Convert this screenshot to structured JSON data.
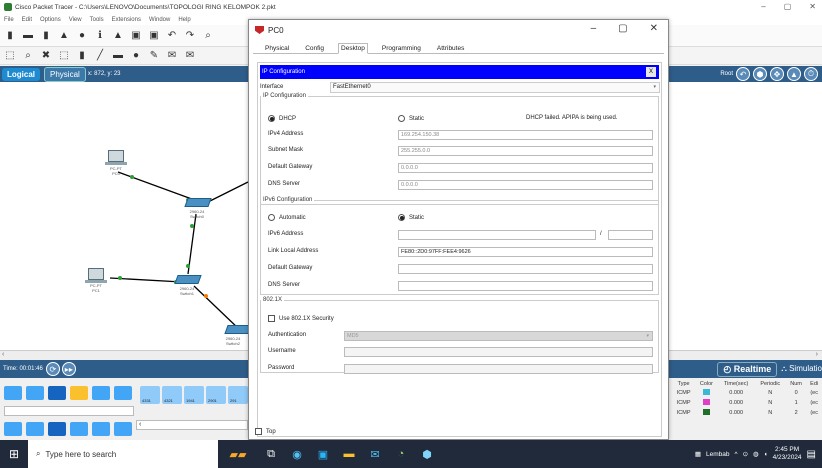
{
  "app": {
    "title": "Cisco Packet Tracer - C:\\Users\\LENOVO\\Documents\\TOPOLOGI RING KELOMPOK 2.pkt",
    "menu": [
      "File",
      "Edit",
      "Options",
      "View",
      "Tools",
      "Extensions",
      "Window",
      "Help"
    ],
    "logical_label": "Logical",
    "physical_label": "Physical",
    "coords": "x: 872, y: 23",
    "root_label": "Root",
    "time_label": "Time: 00:01:46",
    "realtime_label": "Realtime",
    "simulation_label": "Simulatio"
  },
  "devices": [
    {
      "label": "PC-PT\nPC0"
    },
    {
      "label": "2960-24\nSwitch0"
    },
    {
      "label": "PC-PT\nPC1"
    },
    {
      "label": "2960-24\nSwitch1"
    },
    {
      "label": "2960-24\nSwitch2"
    }
  ],
  "device_panel": {
    "model_labels": [
      "4331",
      "4321",
      "1941",
      "2901",
      "291"
    ]
  },
  "event_list": {
    "headers": [
      "Type",
      "Color",
      "Time(sec)",
      "Periodic",
      "Num",
      "Edi"
    ],
    "rows": [
      {
        "type": "ICMP",
        "color": "#3bb8d6",
        "time": "0.000",
        "periodic": "N",
        "num": "0",
        "edit": "(ec"
      },
      {
        "type": "ICMP",
        "color": "#e040c8",
        "time": "0.000",
        "periodic": "N",
        "num": "1",
        "edit": "(ec"
      },
      {
        "type": "ICMP",
        "color": "#1f6e2a",
        "time": "0.000",
        "periodic": "N",
        "num": "2",
        "edit": "(ec"
      }
    ]
  },
  "dialog": {
    "title": "PC0",
    "tabs": [
      "Physical",
      "Config",
      "Desktop",
      "Programming",
      "Attributes"
    ],
    "active_tab": "Desktop",
    "header": "IP Configuration",
    "close_x": "X",
    "interface_label": "Interface",
    "interface_value": "FastEthernet0",
    "ip_config": {
      "legend": "IP Configuration",
      "dhcp_label": "DHCP",
      "static_label": "Static",
      "status": "DHCP failed. APIPA is being used.",
      "ipv4_label": "IPv4 Address",
      "ipv4_value": "169.254.150.38",
      "mask_label": "Subnet Mask",
      "mask_value": "255.255.0.0",
      "gateway_label": "Default Gateway",
      "gateway_value": "0.0.0.0",
      "dns_label": "DNS Server",
      "dns_value": "0.0.0.0"
    },
    "ipv6_config": {
      "legend": "IPv6 Configuration",
      "auto_label": "Automatic",
      "static_label": "Static",
      "ipv6_label": "IPv6 Address",
      "slash": "/",
      "link_local_label": "Link Local Address",
      "link_local_value": "FE80::2D0:97FF:FEE4:9626",
      "gateway_label": "Default Gateway",
      "dns_label": "DNS Server"
    },
    "dot1x": {
      "legend": "802.1X",
      "use_label": "Use 802.1X Security",
      "auth_label": "Authentication",
      "auth_value": "MD5",
      "user_label": "Username",
      "pass_label": "Password"
    },
    "top_label": "Top"
  },
  "taskbar": {
    "search_placeholder": "Type here to search",
    "weather": "Lembab",
    "time": "2:45 PM",
    "date": "4/23/2024"
  }
}
